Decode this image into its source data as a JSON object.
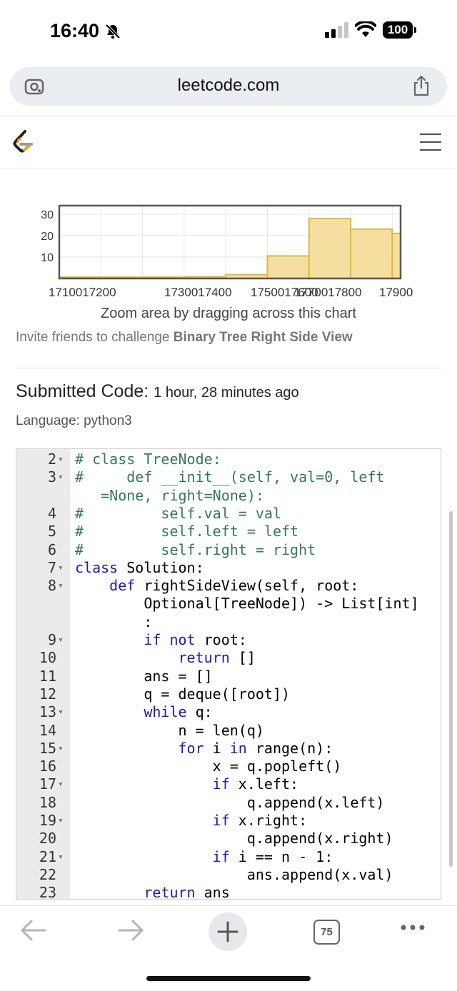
{
  "status_bar": {
    "time": "16:40",
    "battery": "100"
  },
  "browser": {
    "url": "leetcode.com",
    "tab_count": "75"
  },
  "chart_data": {
    "type": "bar",
    "bins": [
      {
        "start": 1710,
        "end": 1720,
        "value": 0.6
      },
      {
        "start": 1720,
        "end": 1730,
        "value": 0.6
      },
      {
        "start": 1730,
        "end": 1740,
        "value": 0.6
      },
      {
        "start": 1740,
        "end": 1750,
        "value": 0.8
      },
      {
        "start": 1750,
        "end": 1760,
        "value": 1.8
      },
      {
        "start": 1760,
        "end": 1770,
        "value": 10.5
      },
      {
        "start": 1770,
        "end": 1780,
        "value": 28
      },
      {
        "start": 1780,
        "end": 1790,
        "value": 23
      },
      {
        "start": 1790,
        "end": 1798,
        "value": 21
      }
    ],
    "xlim": [
      1710,
      1792
    ],
    "ylim": [
      0,
      34
    ],
    "y_ticks": [
      "30",
      "20",
      "10"
    ],
    "x_ticks": [
      "1710017200",
      "1730017400",
      "1750017600",
      "1770017800",
      "17900"
    ],
    "caption": "Zoom area by dragging across this chart",
    "bar_color": "#f5dfa0",
    "bar_stroke": "#e0b93a"
  },
  "invite": {
    "prefix": "Invite friends to challenge ",
    "problem": "Binary Tree Right Side View"
  },
  "submission": {
    "title": "Submitted Code:",
    "time_ago": "1 hour, 28 minutes ago",
    "language": "Language: python3"
  },
  "code_lines": [
    {
      "ln": "2",
      "fold": true,
      "parts": [
        {
          "t": "# class TreeNode:",
          "c": "com"
        }
      ]
    },
    {
      "ln": "3",
      "fold": true,
      "parts": [
        {
          "t": "#     def __init__(self, val=0, left",
          "c": "com"
        }
      ]
    },
    {
      "ln": "",
      "fold": false,
      "parts": [
        {
          "t": "   =None, right=None):",
          "c": "com"
        }
      ]
    },
    {
      "ln": "4",
      "fold": false,
      "parts": [
        {
          "t": "#         self.val = val",
          "c": "com"
        }
      ]
    },
    {
      "ln": "5",
      "fold": false,
      "parts": [
        {
          "t": "#         self.left = left",
          "c": "com"
        }
      ]
    },
    {
      "ln": "6",
      "fold": false,
      "parts": [
        {
          "t": "#         self.right = right",
          "c": "com"
        }
      ]
    },
    {
      "ln": "7",
      "fold": true,
      "parts": [
        {
          "t": "class",
          "c": "kw"
        },
        {
          "t": " Solution:",
          "c": ""
        }
      ]
    },
    {
      "ln": "8",
      "fold": true,
      "parts": [
        {
          "t": "    ",
          "c": ""
        },
        {
          "t": "def",
          "c": "kw"
        },
        {
          "t": " rightSideView(self, root:",
          "c": ""
        }
      ]
    },
    {
      "ln": "",
      "fold": false,
      "parts": [
        {
          "t": "        Optional[TreeNode]) -> List[int]",
          "c": ""
        }
      ]
    },
    {
      "ln": "",
      "fold": false,
      "parts": [
        {
          "t": "        :",
          "c": ""
        }
      ]
    },
    {
      "ln": "9",
      "fold": true,
      "parts": [
        {
          "t": "        ",
          "c": ""
        },
        {
          "t": "if not",
          "c": "kw"
        },
        {
          "t": " root:",
          "c": ""
        }
      ]
    },
    {
      "ln": "10",
      "fold": false,
      "parts": [
        {
          "t": "            ",
          "c": ""
        },
        {
          "t": "return",
          "c": "kw"
        },
        {
          "t": " []",
          "c": ""
        }
      ]
    },
    {
      "ln": "11",
      "fold": false,
      "parts": [
        {
          "t": "        ans = []",
          "c": ""
        }
      ]
    },
    {
      "ln": "12",
      "fold": false,
      "parts": [
        {
          "t": "        q = deque([root])",
          "c": ""
        }
      ]
    },
    {
      "ln": "13",
      "fold": true,
      "parts": [
        {
          "t": "        ",
          "c": ""
        },
        {
          "t": "while",
          "c": "kw"
        },
        {
          "t": " q:",
          "c": ""
        }
      ]
    },
    {
      "ln": "14",
      "fold": false,
      "parts": [
        {
          "t": "            n = len(q)",
          "c": ""
        }
      ]
    },
    {
      "ln": "15",
      "fold": true,
      "parts": [
        {
          "t": "            ",
          "c": ""
        },
        {
          "t": "for",
          "c": "kw"
        },
        {
          "t": " i ",
          "c": ""
        },
        {
          "t": "in",
          "c": "kw"
        },
        {
          "t": " range(n):",
          "c": ""
        }
      ]
    },
    {
      "ln": "16",
      "fold": false,
      "parts": [
        {
          "t": "                x = q.popleft()",
          "c": ""
        }
      ]
    },
    {
      "ln": "17",
      "fold": true,
      "parts": [
        {
          "t": "                ",
          "c": ""
        },
        {
          "t": "if",
          "c": "kw"
        },
        {
          "t": " x.left:",
          "c": ""
        }
      ]
    },
    {
      "ln": "18",
      "fold": false,
      "parts": [
        {
          "t": "                    q.append(x.left)",
          "c": ""
        }
      ]
    },
    {
      "ln": "19",
      "fold": true,
      "parts": [
        {
          "t": "                ",
          "c": ""
        },
        {
          "t": "if",
          "c": "kw"
        },
        {
          "t": " x.right:",
          "c": ""
        }
      ]
    },
    {
      "ln": "20",
      "fold": false,
      "parts": [
        {
          "t": "                    q.append(x.right)",
          "c": ""
        }
      ]
    },
    {
      "ln": "21",
      "fold": true,
      "parts": [
        {
          "t": "                ",
          "c": ""
        },
        {
          "t": "if",
          "c": "kw"
        },
        {
          "t": " i == n - 1:",
          "c": ""
        }
      ]
    },
    {
      "ln": "22",
      "fold": false,
      "parts": [
        {
          "t": "                    ans.append(x.val)",
          "c": ""
        }
      ]
    },
    {
      "ln": "23",
      "fold": false,
      "parts": [
        {
          "t": "        ",
          "c": ""
        },
        {
          "t": "return",
          "c": "kw"
        },
        {
          "t": " ans",
          "c": ""
        }
      ]
    }
  ]
}
